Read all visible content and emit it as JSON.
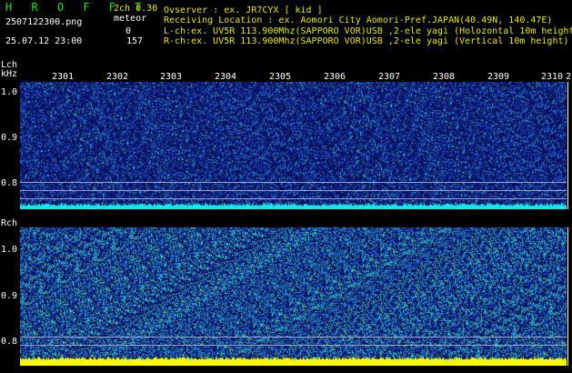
{
  "app": {
    "title": "H R O F F T",
    "channel_mode": "2ch 0.30",
    "file_name": "2507122300.png",
    "meteor_label": "meteor",
    "lch_meteor_count": "0",
    "rch_meteor_count": "157",
    "datetime": "25.07.12 23:00"
  },
  "info": {
    "observer": "Ovserver           : ex. JR7CYX [ kid ]",
    "location": "Receiving Location : ex. Aomori City Aomori-Pref.JAPAN(40.49N, 140.47E)",
    "lch": "L-ch:ex. UV5R 113.900Mhz(SAPPORO VOR)USB ,2-ele yagi (Holozontal 10m height)",
    "rch": "R-ch:ex. UV5R 113.900Mhz(SAPPORO VOR)USB ,2-ele yagi (Vertical 10m height)"
  },
  "time_axis": [
    "2301",
    "2302",
    "2303",
    "2304",
    "2305",
    "2306",
    "2307",
    "2308",
    "2309",
    "2310",
    "2"
  ],
  "lch_panel": {
    "label": "Lch",
    "unit": "kHz",
    "freq_labels": [
      "1.0",
      "0.9",
      "0.8"
    ]
  },
  "rch_panel": {
    "label": "Rch",
    "freq_labels": [
      "1.0",
      "0.9",
      "0.8"
    ]
  },
  "colors": {
    "background": "#000000",
    "panel": "#081060",
    "header_green": "#19e619",
    "header_yellow": "#e6e619",
    "noise_cyan": "#19e6e6",
    "noise_blue": "#1a50c8",
    "meteor_yellow": "#ffff00"
  }
}
